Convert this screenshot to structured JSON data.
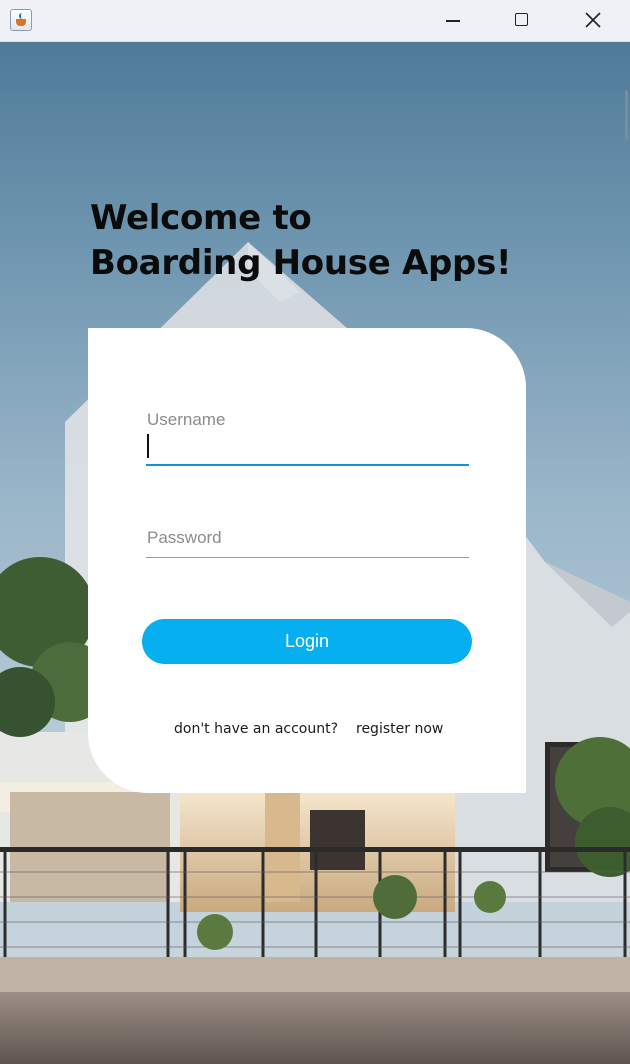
{
  "window": {
    "icon": "java-cup-icon",
    "controls": [
      "minimize-icon",
      "maximize-icon",
      "close-icon"
    ]
  },
  "heading": {
    "line1": "Welcome to",
    "line2": "Boarding House Apps!"
  },
  "login_form": {
    "username_placeholder": "Username",
    "username_value": "",
    "password_placeholder": "Password",
    "password_value": "",
    "login_label": "Login",
    "no_account_text": "don't have an account?",
    "register_link": "register now"
  },
  "colors": {
    "accent": "#05aff0",
    "focus_underline": "#1592d6",
    "card_background": "#ffffff"
  }
}
